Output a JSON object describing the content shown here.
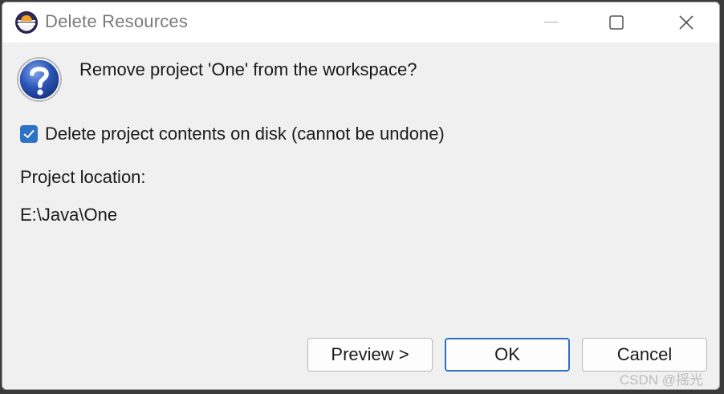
{
  "window": {
    "title": "Delete Resources",
    "app_icon": "eclipse-icon",
    "controls": {
      "minimize_icon": "minimize-icon",
      "maximize_icon": "maximize-icon",
      "close_icon": "close-icon"
    }
  },
  "dialog": {
    "icon": "question-icon",
    "question": "Remove project 'One' from the workspace?",
    "delete_contents": {
      "label": "Delete project contents on disk (cannot be undone)",
      "checked": true
    },
    "location_label": "Project location:",
    "location_value": "E:\\Java\\One"
  },
  "buttons": {
    "preview": "Preview >",
    "ok": "OK",
    "cancel": "Cancel"
  },
  "watermark": "CSDN @摇光",
  "colors": {
    "accent": "#2d72c4",
    "dialog_bg": "#f0f0f0",
    "titlebar_bg": "#ffffff"
  }
}
